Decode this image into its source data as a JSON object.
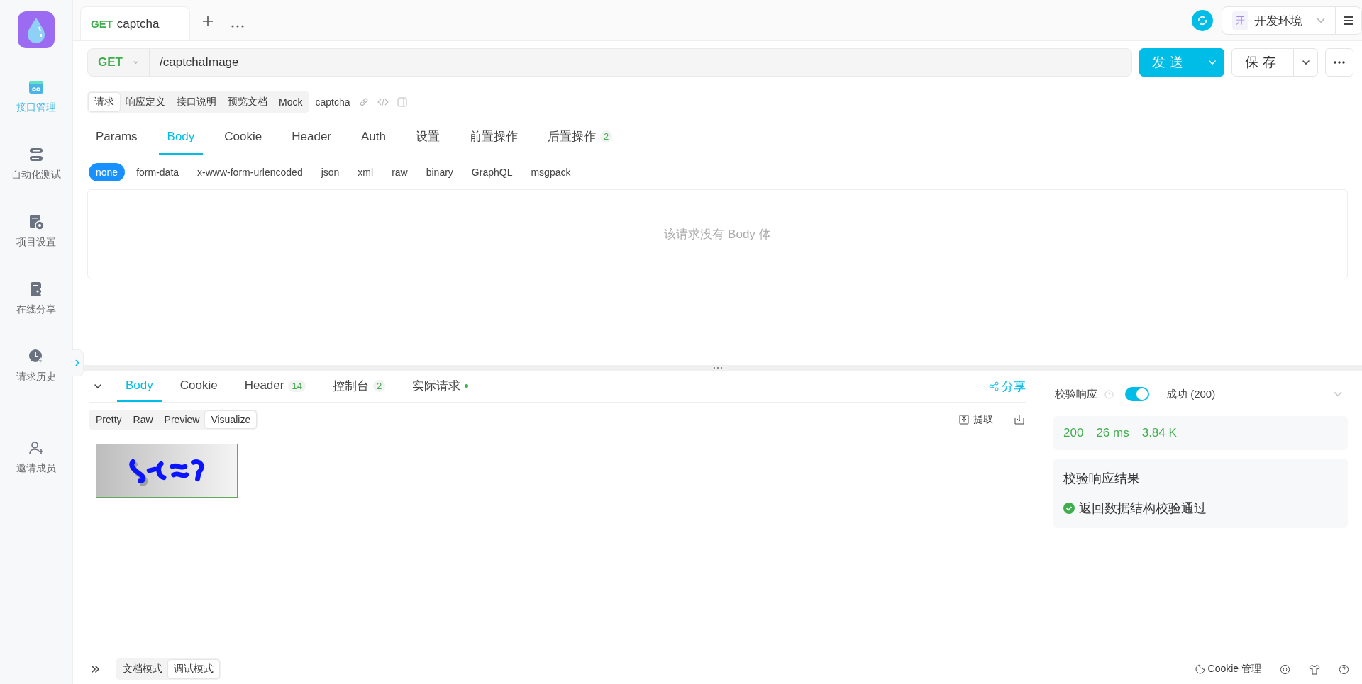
{
  "sidebar": {
    "items": [
      {
        "label": "接口管理",
        "selected": true
      },
      {
        "label": "自动化测试",
        "selected": false
      },
      {
        "label": "项目设置",
        "selected": false
      },
      {
        "label": "在线分享",
        "selected": false
      },
      {
        "label": "请求历史",
        "selected": false
      },
      {
        "label": "邀请成员",
        "selected": false
      }
    ]
  },
  "request_tabs": [
    {
      "method": "GET",
      "name": "captcha",
      "selected": true
    }
  ],
  "environment": {
    "badge": "开",
    "name": "开发环境"
  },
  "url_bar": {
    "method": "GET",
    "path": "/captchaImage"
  },
  "send_button": "发送",
  "save_button": "保存",
  "doc_tabs": [
    {
      "label": "请求",
      "selected": true
    },
    {
      "label": "响应定义",
      "selected": false
    },
    {
      "label": "接口说明",
      "selected": false
    },
    {
      "label": "预览文档",
      "selected": false
    },
    {
      "label": "Mock",
      "selected": false
    }
  ],
  "doc_name": "captcha",
  "param_tabs": [
    {
      "label": "Params",
      "selected": false
    },
    {
      "label": "Body",
      "selected": true
    },
    {
      "label": "Cookie",
      "selected": false
    },
    {
      "label": "Header",
      "selected": false
    },
    {
      "label": "Auth",
      "selected": false
    },
    {
      "label": "设置",
      "selected": false
    },
    {
      "label": "前置操作",
      "selected": false
    },
    {
      "label": "后置操作",
      "count": "2",
      "selected": false
    }
  ],
  "body_types": [
    {
      "label": "none",
      "selected": true
    },
    {
      "label": "form-data",
      "selected": false
    },
    {
      "label": "x-www-form-urlencoded",
      "selected": false
    },
    {
      "label": "json",
      "selected": false
    },
    {
      "label": "xml",
      "selected": false
    },
    {
      "label": "raw",
      "selected": false
    },
    {
      "label": "binary",
      "selected": false
    },
    {
      "label": "GraphQL",
      "selected": false
    },
    {
      "label": "msgpack",
      "selected": false
    }
  ],
  "body_empty": "该请求没有 Body 体",
  "response": {
    "tabs": [
      {
        "label": "Body",
        "selected": true,
        "dot": false
      },
      {
        "label": "Cookie",
        "selected": false,
        "dot": false
      },
      {
        "label": "Header",
        "count": "14",
        "selected": false,
        "dot": false
      },
      {
        "label": "控制台",
        "count": "2",
        "selected": false,
        "dot": false
      },
      {
        "label": "实际请求",
        "selected": false,
        "dot": true
      }
    ],
    "share": "分享",
    "view_modes": [
      {
        "label": "Pretty",
        "selected": false
      },
      {
        "label": "Raw",
        "selected": false
      },
      {
        "label": "Preview",
        "selected": false
      },
      {
        "label": "Visualize",
        "selected": true
      }
    ],
    "extract": "提取"
  },
  "validation": {
    "label": "校验响应",
    "on": true,
    "status": "成功 (200)",
    "code": "200",
    "time": "26 ms",
    "size": "3.84 K",
    "result_title": "校验响应结果",
    "result": "返回数据结构校验通过"
  },
  "footer": {
    "modes": [
      {
        "label": "文档模式",
        "selected": false
      },
      {
        "label": "调试模式",
        "selected": true
      }
    ],
    "cookie": "Cookie 管理"
  }
}
